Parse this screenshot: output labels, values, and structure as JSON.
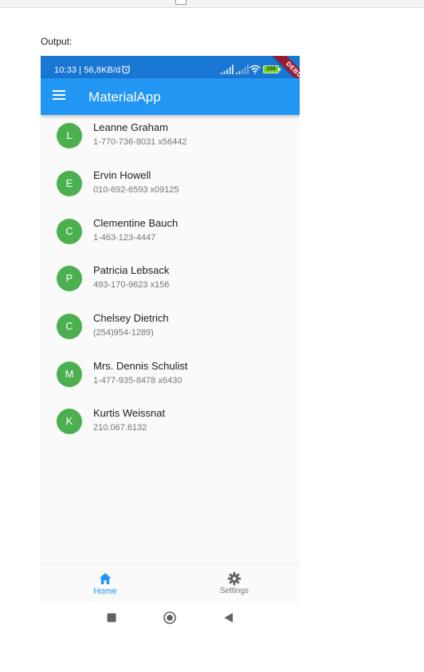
{
  "page": {
    "output_label": "Output:"
  },
  "status_bar": {
    "time": "10:33 | 56,8KB/d",
    "battery": "100",
    "debug_banner": "DEBUG",
    "icons": [
      "alarm-icon",
      "signal-icon",
      "signal-icon",
      "wifi-icon",
      "battery-icon"
    ]
  },
  "app_bar": {
    "title": "MaterialApp",
    "menu_icon": "menu-icon",
    "color": "#2196f3",
    "status_color": "#1976d2"
  },
  "contacts": [
    {
      "initial": "L",
      "name": "Leanne Graham",
      "phone": "1-770-736-8031 x56442"
    },
    {
      "initial": "E",
      "name": "Ervin Howell",
      "phone": "010-692-6593 x09125"
    },
    {
      "initial": "C",
      "name": "Clementine Bauch",
      "phone": "1-463-123-4447"
    },
    {
      "initial": "P",
      "name": "Patricia Lebsack",
      "phone": "493-170-9623 x156"
    },
    {
      "initial": "C",
      "name": "Chelsey Dietrich",
      "phone": "(254)954-1289)"
    },
    {
      "initial": "M",
      "name": "Mrs. Dennis Schulist",
      "phone": "1-477-935-8478 x6430"
    },
    {
      "initial": "K",
      "name": "Kurtis Weissnat",
      "phone": "210.067.6132"
    }
  ],
  "avatar_color": "#4caf50",
  "bottom_nav": [
    {
      "label": "Home",
      "icon": "home-icon",
      "active": true
    },
    {
      "label": "Settings",
      "icon": "gear-icon",
      "active": false
    }
  ],
  "system_nav": [
    "recents-square-icon",
    "home-circle-icon",
    "back-triangle-icon"
  ]
}
